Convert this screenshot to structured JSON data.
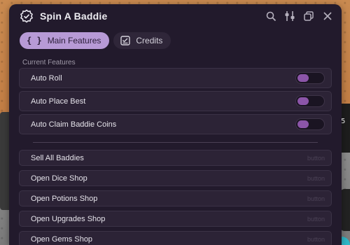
{
  "window": {
    "title": "Spin A Baddie"
  },
  "titlebar_icons": [
    "search-icon",
    "settings-sliders-icon",
    "minimize-window-icon",
    "close-icon"
  ],
  "tabs": [
    {
      "label": "Main Features",
      "icon": "braces-icon",
      "active": true
    },
    {
      "label": "Credits",
      "icon": "checklist-icon",
      "active": false
    }
  ],
  "section": {
    "label": "Current Features"
  },
  "toggles": [
    {
      "label": "Auto Roll",
      "enabled": false
    },
    {
      "label": "Auto Place Best",
      "enabled": false
    },
    {
      "label": "Auto Claim Baddie Coins",
      "enabled": false
    }
  ],
  "buttons": [
    {
      "label": "Sell All Baddies",
      "hint": "button"
    },
    {
      "label": "Open Dice Shop",
      "hint": "button"
    },
    {
      "label": "Open Potions Shop",
      "hint": "button"
    },
    {
      "label": "Open Upgrades Shop",
      "hint": "button"
    },
    {
      "label": "Open Gems Shop",
      "hint": "button"
    }
  ],
  "background": {
    "right_panel_text": "5"
  },
  "colors": {
    "accent": "#b79ad6",
    "toggle_knob": "#8b55a8",
    "window_bg": "#221a2c",
    "row_bg": "#2c2336"
  }
}
